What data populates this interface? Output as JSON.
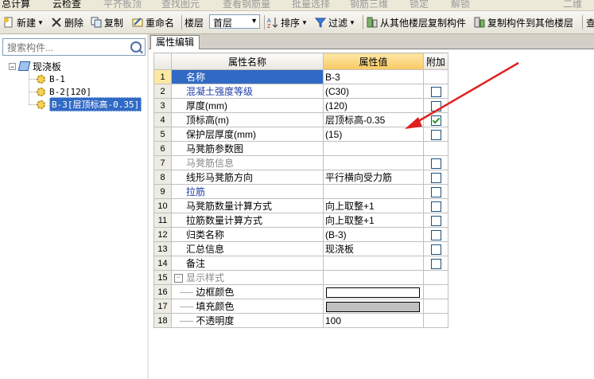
{
  "top_strip": [
    "总计算",
    "云检查",
    "平齐板顶",
    "查找图元",
    "查看钢筋量",
    "批量选择",
    "钢筋三维",
    "锁定",
    "解锁",
    "二维"
  ],
  "toolbar": {
    "new_label": "新建",
    "delete_label": "删除",
    "copy_label": "复制",
    "rename_label": "重命名",
    "floor_label": "楼层",
    "floor_value": "首层",
    "sort_label": "排序",
    "filter_label": "过滤",
    "copy_from_label": "从其他楼层复制构件",
    "copy_to_label": "复制构件到其他楼层",
    "overflow_label": "查"
  },
  "search": {
    "placeholder": "搜索构件..."
  },
  "tree": {
    "root": "现浇板",
    "items": [
      "B-1",
      "B-2[120]",
      "B-3[层顶标高-0.35]"
    ]
  },
  "tab_label": "属性编辑",
  "grid": {
    "header_name": "属性名称",
    "header_value": "属性值",
    "header_add": "附加",
    "rows": [
      {
        "num": "1",
        "name": "名称",
        "value": "B-3"
      },
      {
        "num": "2",
        "name": "混凝土强度等级",
        "value": "(C30)"
      },
      {
        "num": "3",
        "name": "厚度(mm)",
        "value": "(120)"
      },
      {
        "num": "4",
        "name": "顶标高(m)",
        "value": "层顶标高-0.35"
      },
      {
        "num": "5",
        "name": "保护层厚度(mm)",
        "value": "(15)"
      },
      {
        "num": "6",
        "name": "马凳筋参数图",
        "value": ""
      },
      {
        "num": "7",
        "name": "马凳筋信息",
        "value": ""
      },
      {
        "num": "8",
        "name": "线形马凳筋方向",
        "value": "平行横向受力筋"
      },
      {
        "num": "9",
        "name": "拉筋",
        "value": ""
      },
      {
        "num": "10",
        "name": "马凳筋数量计算方式",
        "value": "向上取整+1"
      },
      {
        "num": "11",
        "name": "拉筋数量计算方式",
        "value": "向上取整+1"
      },
      {
        "num": "12",
        "name": "归类名称",
        "value": "(B-3)"
      },
      {
        "num": "13",
        "name": "汇总信息",
        "value": "现浇板"
      },
      {
        "num": "14",
        "name": "备注",
        "value": ""
      },
      {
        "num": "15",
        "name": "显示样式",
        "value": ""
      },
      {
        "num": "16",
        "name": "边框颜色",
        "value": ""
      },
      {
        "num": "17",
        "name": "填充颜色",
        "value": ""
      },
      {
        "num": "18",
        "name": "不透明度",
        "value": "100"
      }
    ],
    "colors": {
      "border_color": "#ffffff",
      "fill_color": "#c0c0c0"
    },
    "checked_row": "4"
  },
  "accent": {
    "selection": "#316ac5",
    "arrow": "#e02020"
  }
}
